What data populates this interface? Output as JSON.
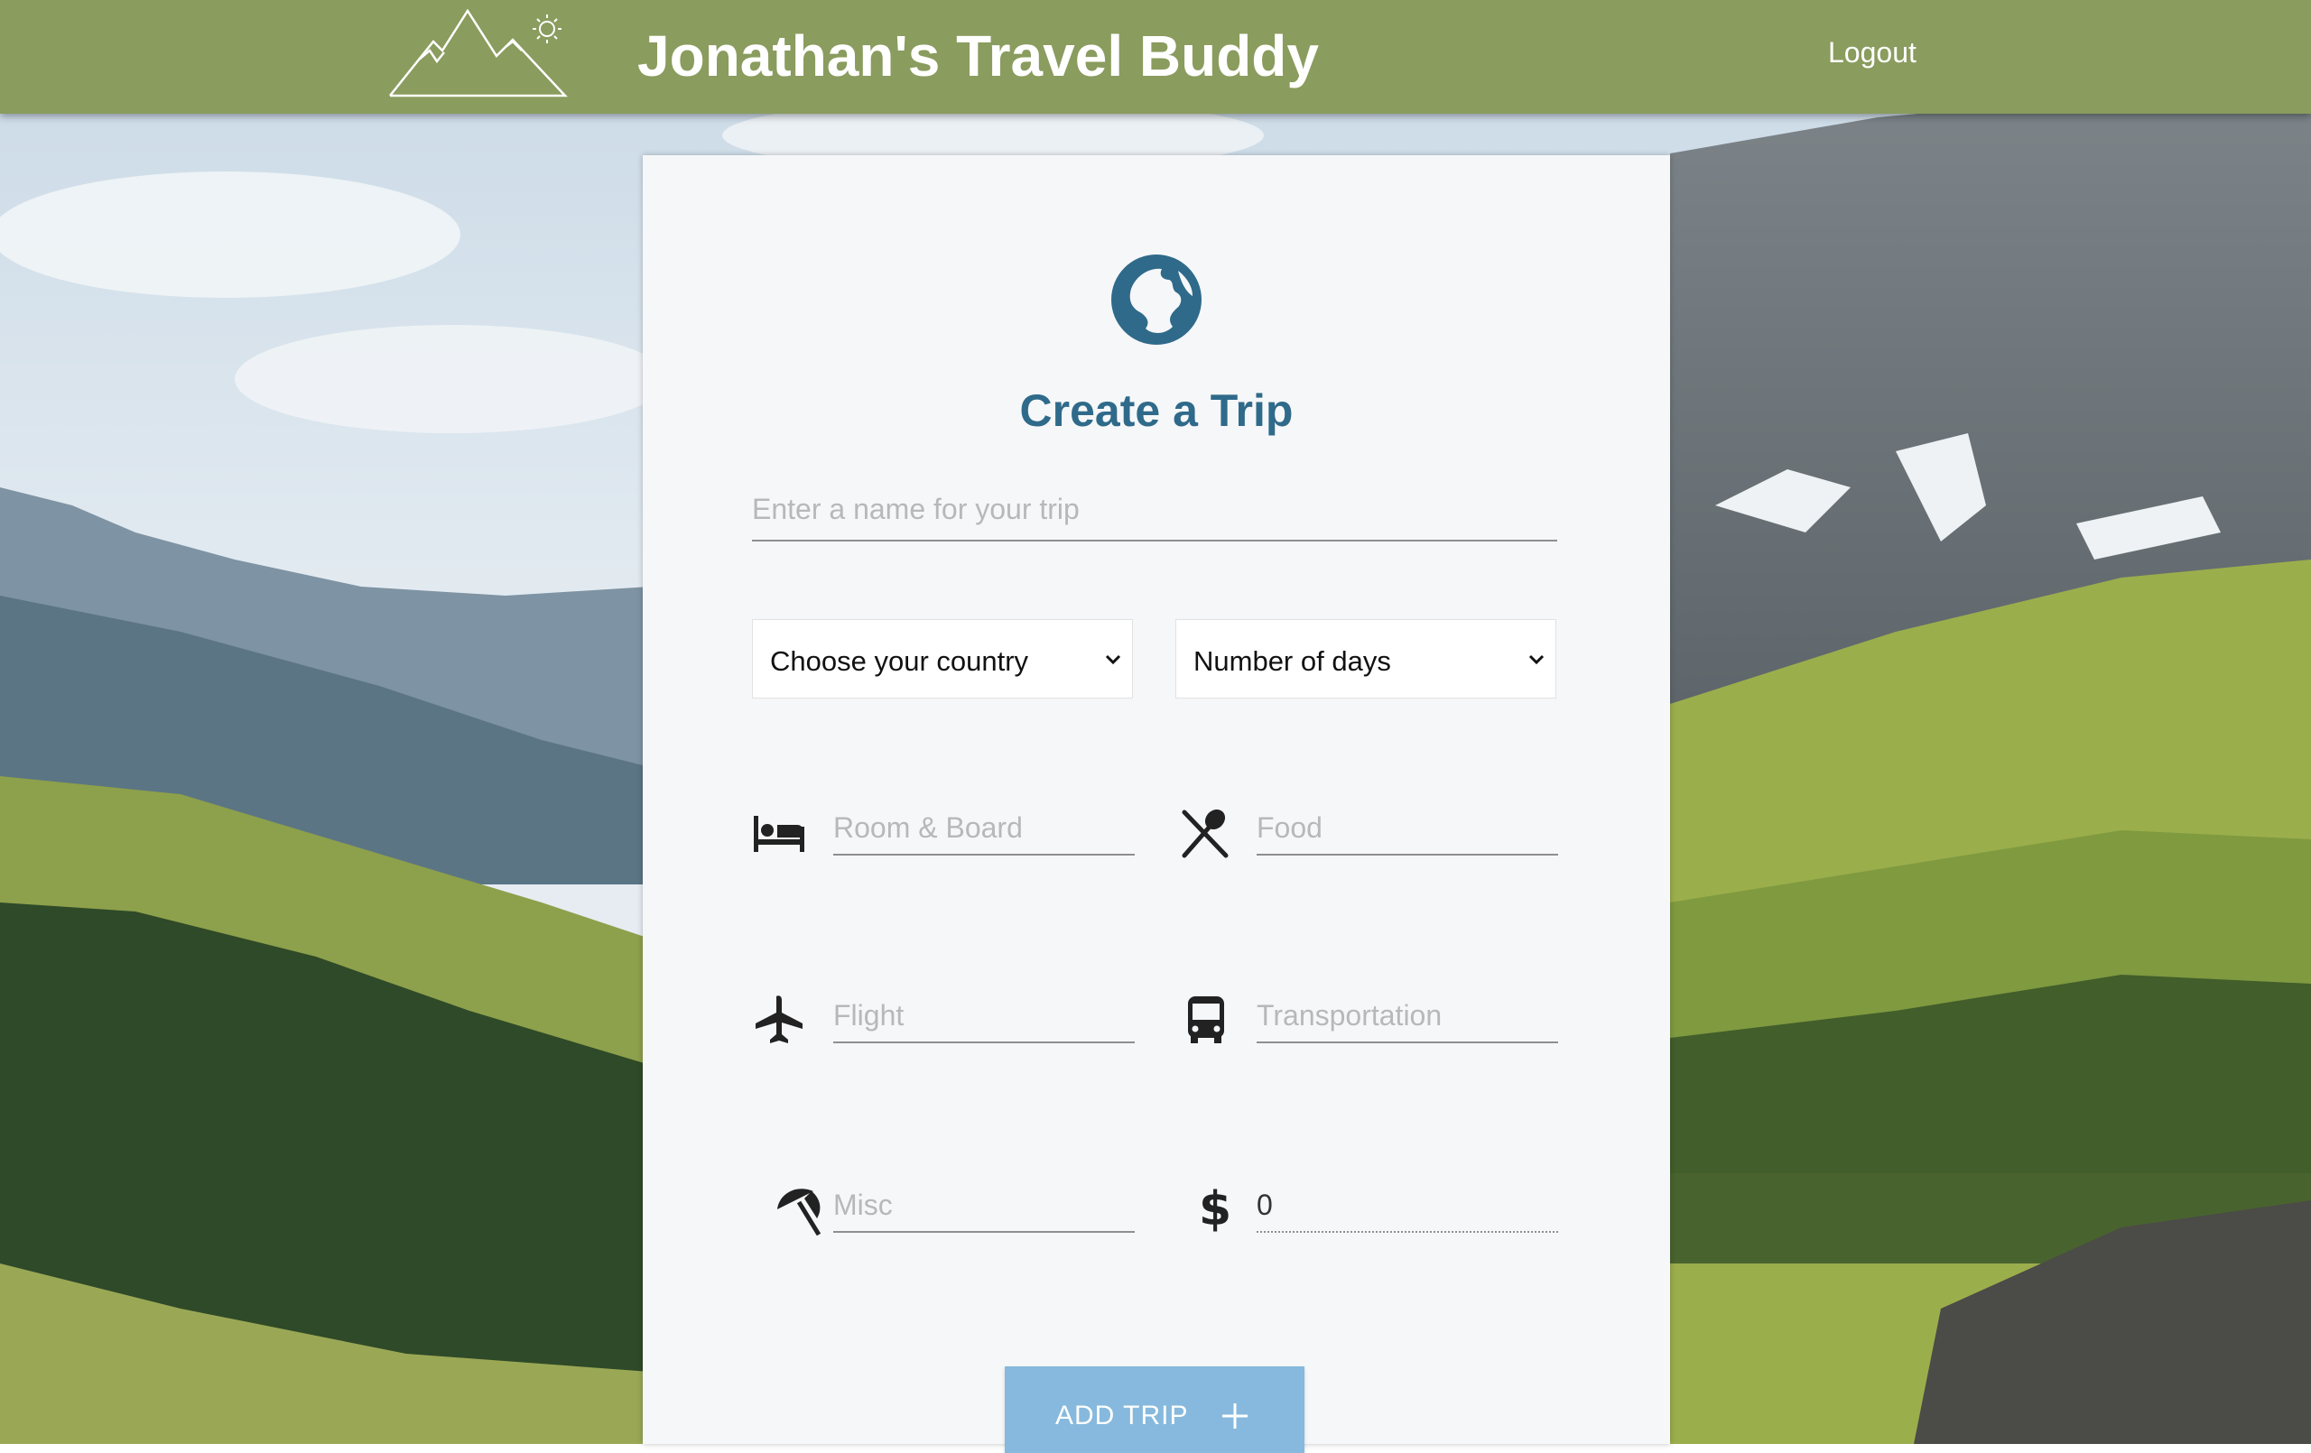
{
  "header": {
    "app_title": "Jonathan's Travel Buddy",
    "logout_label": "Logout"
  },
  "card": {
    "title": "Create a Trip",
    "trip_name_placeholder": "Enter a name for your trip",
    "country_select": {
      "selected": "Choose your country"
    },
    "days_select": {
      "selected": "Number of days"
    },
    "fields": {
      "room_board": {
        "placeholder": "Room & Board",
        "icon": "bed-icon"
      },
      "food": {
        "placeholder": "Food",
        "icon": "utensils-icon"
      },
      "flight": {
        "placeholder": "Flight",
        "icon": "plane-icon"
      },
      "transportation": {
        "placeholder": "Transportation",
        "icon": "bus-icon"
      },
      "misc": {
        "placeholder": "Misc",
        "icon": "umbrella-beach-icon"
      },
      "total": {
        "value": "0",
        "icon": "dollar-icon"
      }
    },
    "add_button_label": "ADD TRIP"
  },
  "colors": {
    "header_bg": "#8a9c5e",
    "title_blue": "#2f6a8a",
    "button_blue": "#86b9dd",
    "card_bg": "#f6f7f9"
  }
}
